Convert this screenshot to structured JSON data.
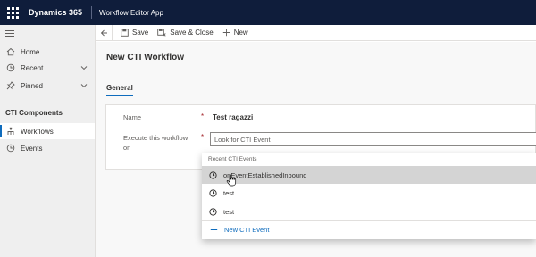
{
  "header": {
    "brand": "Dynamics 365",
    "app_name": "Workflow Editor App"
  },
  "sidebar": {
    "items": [
      {
        "label": "Home",
        "icon": "home-icon"
      },
      {
        "label": "Recent",
        "icon": "clock-icon"
      },
      {
        "label": "Pinned",
        "icon": "pin-icon"
      }
    ],
    "section_label": "CTI Components",
    "components": [
      {
        "label": "Workflows",
        "icon": "workflow-icon",
        "selected": true
      },
      {
        "label": "Events",
        "icon": "clock-icon",
        "selected": false
      }
    ]
  },
  "commandbar": {
    "save": "Save",
    "save_close": "Save & Close",
    "new": "New"
  },
  "form": {
    "title": "New CTI Workflow",
    "tab": "General",
    "name_label": "Name",
    "name_value": "Test ragazzi",
    "execute_label_line1": "Execute this workflow",
    "execute_label_line2": "on",
    "required_marker": "*",
    "lookup_placeholder": "Look for CTI Event"
  },
  "flyout": {
    "header": "Recent CTI Events",
    "items": [
      {
        "label": "onEventEstablishedInbound",
        "hovered": true
      },
      {
        "label": "test",
        "hovered": false
      },
      {
        "label": "test",
        "hovered": false
      }
    ],
    "new_label": "New CTI Event"
  },
  "colors": {
    "topbar": "#0f1d3b",
    "accent": "#0f6cbd",
    "required": "#a4262c",
    "hover": "#d4d4d4"
  }
}
